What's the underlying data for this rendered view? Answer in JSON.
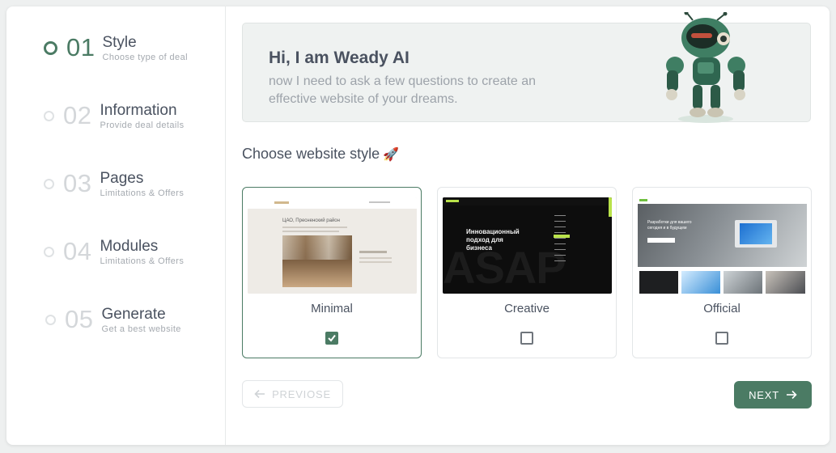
{
  "steps": [
    {
      "number": "01",
      "title": "Style",
      "subtitle": "Choose type of deal",
      "active": true
    },
    {
      "number": "02",
      "title": "Information",
      "subtitle": "Provide deal details",
      "active": false
    },
    {
      "number": "03",
      "title": "Pages",
      "subtitle": "Limitations & Offers",
      "active": false
    },
    {
      "number": "04",
      "title": "Modules",
      "subtitle": "Limitations & Offers",
      "active": false
    },
    {
      "number": "05",
      "title": "Generate",
      "subtitle": "Get a best website",
      "active": false
    }
  ],
  "hero": {
    "title": "Hi, I am Weady AI",
    "subtitle": "now I need to ask a few questions to create an effective website of your dreams."
  },
  "section_title": "Choose website style",
  "section_emoji": "🚀",
  "styles": [
    {
      "label": "Minimal",
      "checked": true
    },
    {
      "label": "Creative",
      "checked": false
    },
    {
      "label": "Official",
      "checked": false
    }
  ],
  "previews": {
    "minimal_heading": "ЦАО, Пресненский район",
    "creative_heading": "Инновационный подход для бизнеса",
    "creative_bg_word": "ASAP",
    "official_heading": "Разработки для вашего сегодня и в будущем"
  },
  "buttons": {
    "prev_label": "PREVIOSE",
    "next_label": "NEXT"
  },
  "colors": {
    "accent": "#4b7b64",
    "hero_bg": "#eff2f1"
  },
  "icons": {
    "prev": "arrow-left-icon",
    "next": "arrow-right-icon",
    "check": "check-icon",
    "robot": "robot-illustration"
  }
}
